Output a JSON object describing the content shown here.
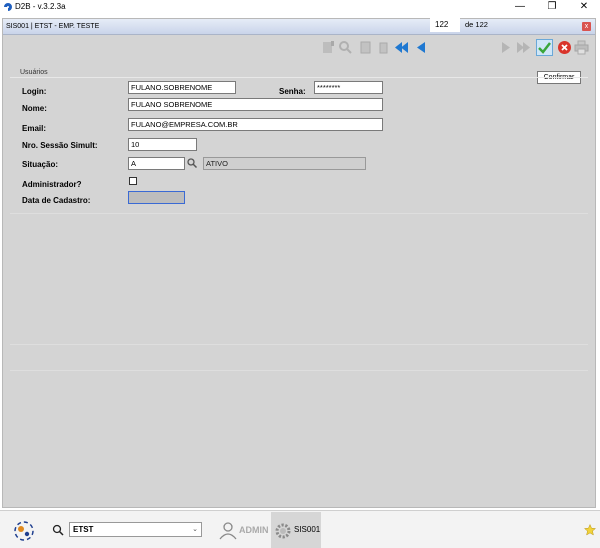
{
  "window": {
    "title": "D2B - v.3.2.3a",
    "minimize": "—",
    "restore": "❐",
    "close": "✕"
  },
  "inner": {
    "title": "SIS001 | ETST - EMP. TESTE",
    "close": "x"
  },
  "toolbar": {
    "record_current": "122",
    "record_total_text": "de 122",
    "tooltip": "Confirmar"
  },
  "form": {
    "section": "Usuários",
    "login_label": "Login:",
    "login_value": "FULANO.SOBRENOME",
    "senha_label": "Senha:",
    "senha_value": "********",
    "nome_label": "Nome:",
    "nome_value": "FULANO SOBRENOME",
    "email_label": "Email:",
    "email_value": "FULANO@EMPRESA.COM.BR",
    "sessao_label": "Nro. Sessão Simult:",
    "sessao_value": "10",
    "situacao_label": "Situação:",
    "situacao_code": "A",
    "situacao_desc": "ATIVO",
    "admin_label": "Administrador?",
    "admin_checked": false,
    "cadastro_label": "Data de Cadastro:",
    "cadastro_value": ""
  },
  "taskbar": {
    "company": "ETST",
    "user": "ADMIN",
    "module": "SIS001"
  },
  "colors": {
    "confirm": "#3aa63a",
    "cancel": "#d9342b",
    "nav": "#1f78d1"
  }
}
